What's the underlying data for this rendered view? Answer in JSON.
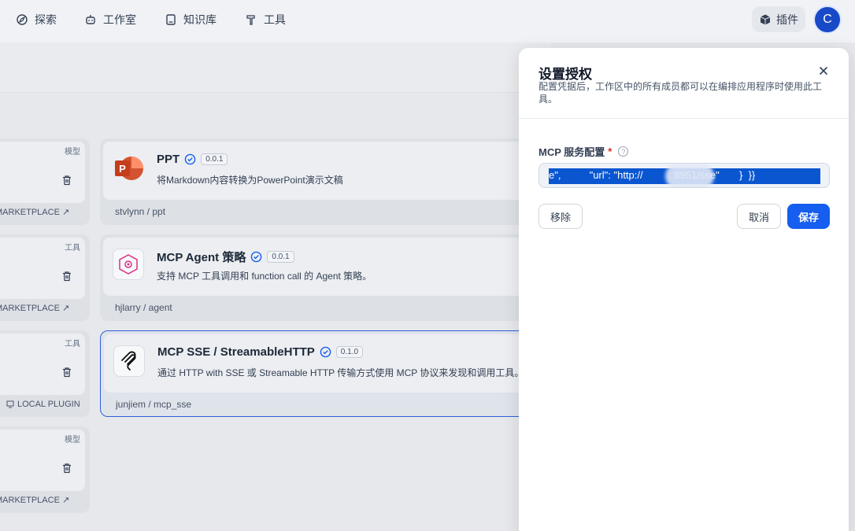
{
  "nav": {
    "items": [
      {
        "label": "探索",
        "icon": "compass-icon"
      },
      {
        "label": "工作室",
        "icon": "robot-icon"
      },
      {
        "label": "知识库",
        "icon": "book-icon"
      },
      {
        "label": "工具",
        "icon": "hammer-icon"
      }
    ],
    "plugins_label": "插件",
    "avatar_initial": "C"
  },
  "left_cards": [
    {
      "tag": "模型",
      "footer": "MARKETPLACE ↗"
    },
    {
      "tag": "工具",
      "footer": "MARKETPLACE ↗"
    },
    {
      "tag": "工具",
      "footer": "LOCAL PLUGIN"
    },
    {
      "tag": "模型",
      "footer": "MARKETPLACE ↗"
    }
  ],
  "plugins": [
    {
      "name": "PPT",
      "version": "0.0.1",
      "desc": "将Markdown内容转换为PowerPoint演示文稿",
      "author": "stvlynn / ppt"
    },
    {
      "name": "MCP Agent 策略",
      "version": "0.0.1",
      "desc": "支持 MCP 工具调用和 function call 的 Agent 策略。",
      "author": "hjlarry / agent"
    },
    {
      "name": "MCP SSE / StreamableHTTP",
      "version": "0.1.0",
      "desc": "通过 HTTP with SSE 或 Streamable HTTP 传输方式使用 MCP 协议来发现和调用工具。",
      "author": "junjiem / mcp_sse"
    }
  ],
  "dialog": {
    "title": "设置授权",
    "subtitle": "配置凭据后，工作区中的所有成员都可以在编排应用程序时使用此工具。",
    "field_label": "MCP 服务配置",
    "required_mark": "*",
    "help_mark": "?",
    "field_value": "e\",          \"url\": \"http://           8951/sse\"       }  }}",
    "remove_label": "移除",
    "cancel_label": "取消",
    "save_label": "保存"
  },
  "colors": {
    "accent": "#155eef",
    "selection": "#0a56d0",
    "avatar": "#1849c7"
  }
}
